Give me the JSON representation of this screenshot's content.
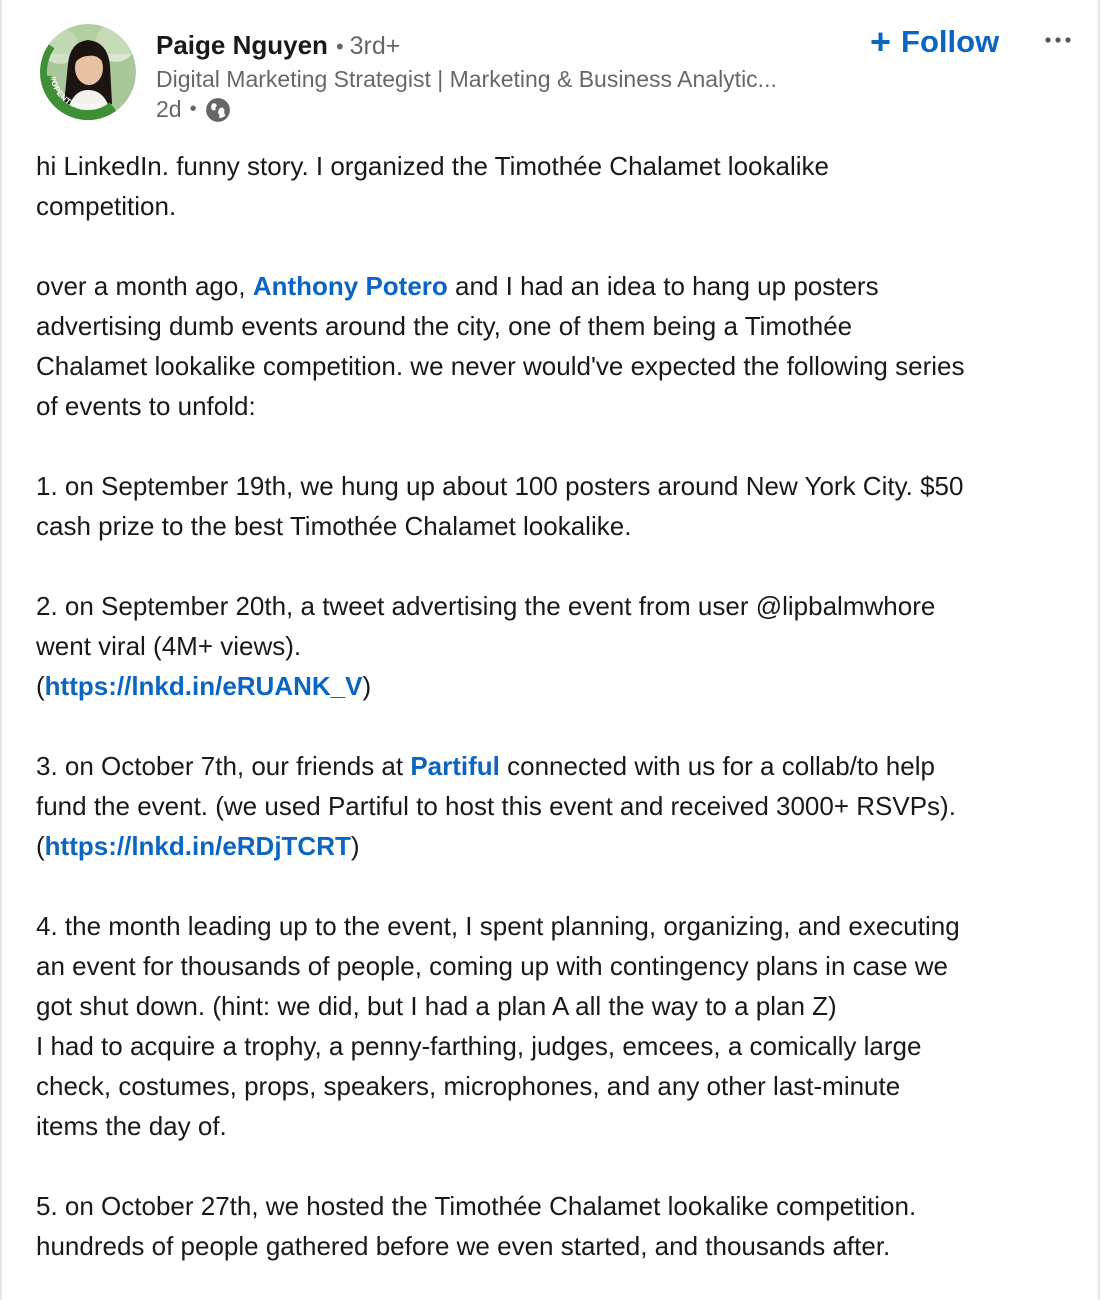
{
  "author": {
    "name": "Paige Nguyen",
    "degree": "3rd+",
    "separator": "•",
    "headline": "Digital Marketing Strategist | Marketing & Business Analytic...",
    "time": "2d",
    "time_separator": "•",
    "visibility_icon": "globe-icon",
    "avatar_badge": "#OPENTOWORK"
  },
  "actions": {
    "follow_plus": "+",
    "follow_label": "Follow",
    "more_icon": "ellipsis-icon"
  },
  "post": {
    "p1": {
      "l1": "hi LinkedIn. funny story. I organized the Timothée Chalamet lookalike",
      "l2": "competition."
    },
    "p2": {
      "l1_a": "over a month ago, ",
      "l1_mention": "Anthony Potero",
      "l1_b": " and I had an idea to hang up posters",
      "l2": "advertising dumb events around the city, one of them being a Timothée",
      "l3": "Chalamet lookalike competition. we never would've expected the following series",
      "l4": "of events to unfold:"
    },
    "p3": {
      "l1": "1. on September 19th, we hung up about 100 posters around New York City. $50",
      "l2": "cash prize to the best Timothée Chalamet lookalike."
    },
    "p4": {
      "l1": "2. on September 20th, a tweet advertising the event from user @lipbalmwhore",
      "l2": "went viral (4M+ views).",
      "l3_open": "(",
      "l3_link": "https://lnkd.in/eRUANK_V",
      "l3_close": ")"
    },
    "p5": {
      "l1_a": "3. on October 7th, our friends at ",
      "l1_mention": "Partiful",
      "l1_b": " connected with us for a collab/to help",
      "l2": "fund the event. (we used Partiful to host this event and received 3000+ RSVPs).",
      "l3_open": "(",
      "l3_link": "https://lnkd.in/eRDjTCRT",
      "l3_close": ")"
    },
    "p6": {
      "l1": "4. the month leading up to the event, I spent planning, organizing, and executing",
      "l2": "an event for thousands of people, coming up with contingency plans in case we",
      "l3": "got shut down. (hint: we did, but I had a plan A all the way to a plan Z)",
      "l4": "I had to acquire a trophy, a penny-farthing, judges, emcees, a comically large",
      "l5": "check, costumes, props, speakers, microphones, and any other last-minute",
      "l6": "items the day of."
    },
    "p7": {
      "l1": "5. on October 27th, we hosted the Timothée Chalamet lookalike competition.",
      "l2": "hundreds of people gathered before we even started, and thousands after."
    }
  },
  "colors": {
    "link": "#0a66c2",
    "text": "#1a1a1a",
    "muted": "#666666",
    "open_to_work_green": "#3f8f36"
  }
}
